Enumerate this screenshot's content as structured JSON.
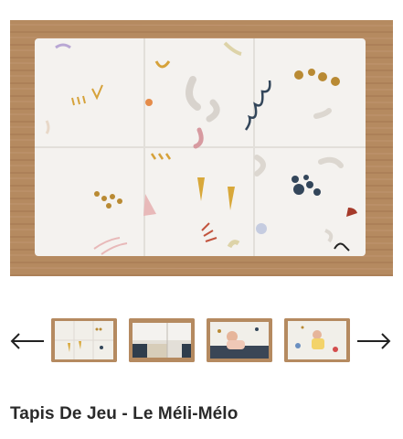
{
  "product": {
    "title": "Tapis De Jeu - Le Méli-Mélo"
  },
  "gallery": {
    "main_image": "playmat-main-photo",
    "thumbnails": [
      {
        "name": "thumbnail-1",
        "selected": true
      },
      {
        "name": "thumbnail-2",
        "selected": false
      },
      {
        "name": "thumbnail-3",
        "selected": false
      },
      {
        "name": "thumbnail-4",
        "selected": false
      }
    ],
    "prev_icon": "arrow-left-icon",
    "next_icon": "arrow-right-icon"
  },
  "colors": {
    "wood_floor": "#b58a60",
    "mat": "#f4f2ef",
    "title_text": "#2a2a2a"
  }
}
